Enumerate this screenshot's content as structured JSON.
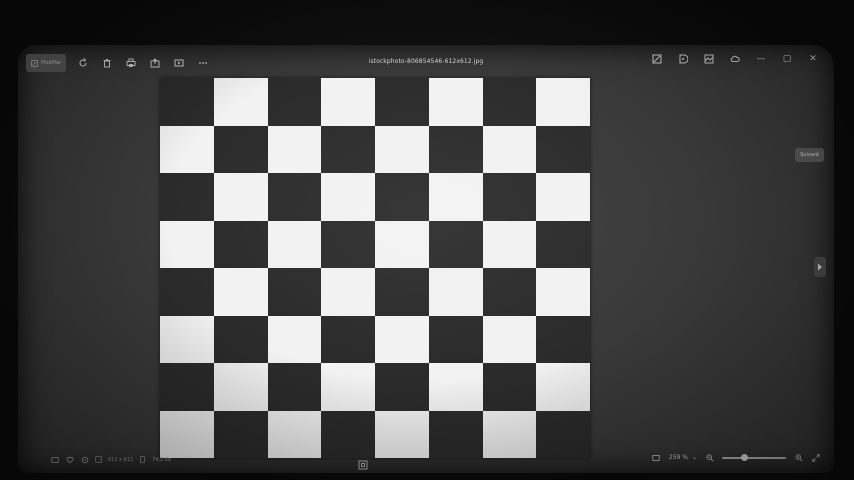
{
  "app": {
    "file_name": "istockphoto-806854546-612x612.jpg"
  },
  "toolbar": {
    "modify_label": "Modifier",
    "icons": [
      "modify-icon",
      "rotate-icon",
      "delete-icon",
      "print-icon",
      "share-icon",
      "slideshow-icon",
      "more-icon"
    ],
    "right_icons": [
      "crop-icon",
      "edit-image-icon",
      "gallery-icon",
      "cloud-icon"
    ]
  },
  "window": {
    "minimize": "—",
    "maximize": "▢",
    "close": "✕"
  },
  "side": {
    "next_label": "Suivant"
  },
  "image": {
    "rows": 8,
    "cols": 8,
    "top_left": "dark"
  },
  "status": {
    "dimensions": "612 x 612",
    "file_size": "74,2 Ko",
    "zoom": "259 %",
    "zoom_level": 0.34
  }
}
